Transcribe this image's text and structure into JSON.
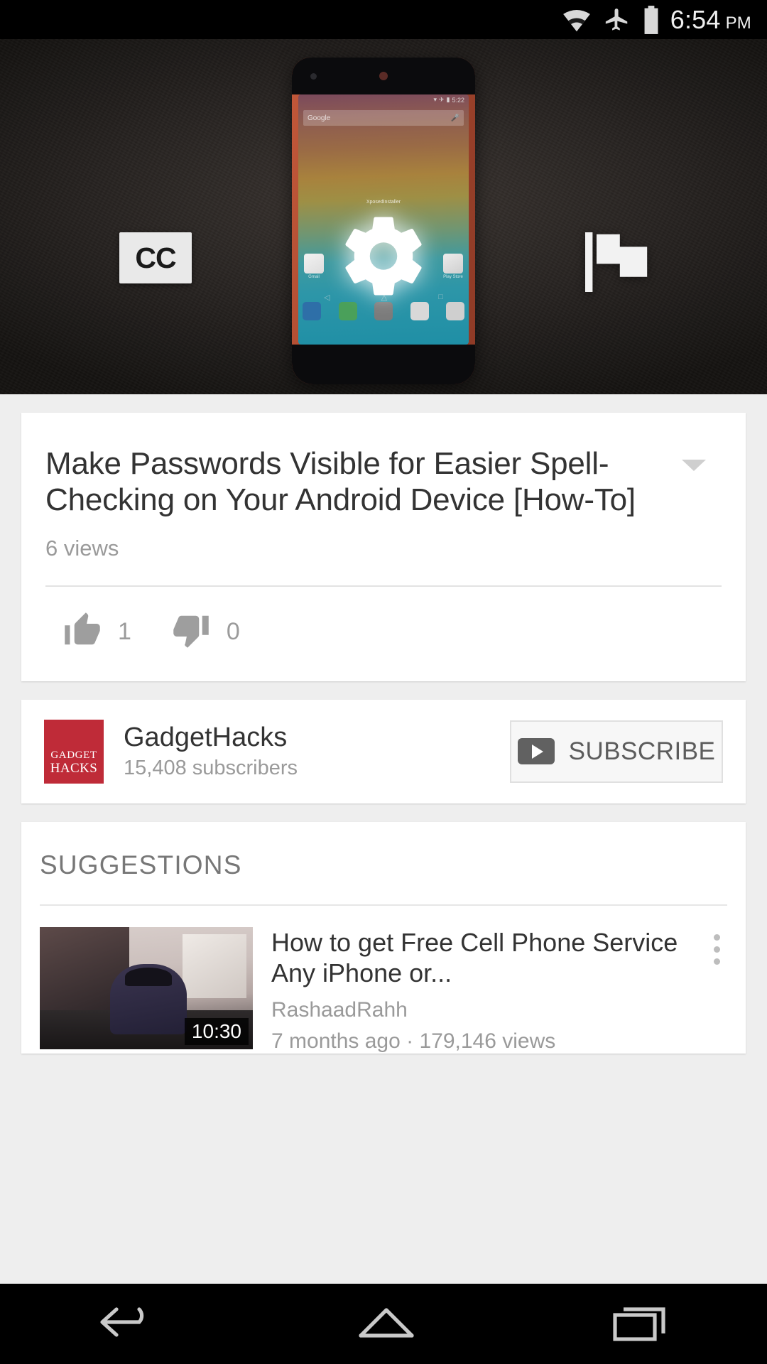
{
  "status_bar": {
    "wifi_icon": "wifi-icon",
    "airplane_icon": "airplane-mode-icon",
    "battery_icon": "battery-icon",
    "time": "6:54",
    "am_pm": "PM"
  },
  "player": {
    "cc_label": "CC",
    "settings_icon": "gear-icon",
    "flag_icon": "flag-icon",
    "thumbnail_phone": {
      "status_time": "5:22",
      "search_placeholder": "Google",
      "app_label": "XposedInstaller",
      "app_gmail": "Gmail",
      "app_playstore": "Play Store"
    }
  },
  "video": {
    "title": "Make Passwords Visible for Easier Spell-Checking on Your Android Device [How-To]",
    "views": "6 views",
    "expand_icon": "chevron-down-icon",
    "like_icon": "thumbs-up-icon",
    "like_count": "1",
    "dislike_icon": "thumbs-down-icon",
    "dislike_count": "0"
  },
  "channel": {
    "avatar_line1": "GADGET",
    "avatar_line2": "HACKS",
    "name": "GadgetHacks",
    "subscribers": "15,408 subscribers",
    "subscribe_label": "SUBSCRIBE",
    "subscribe_icon": "youtube-play-icon"
  },
  "suggestions": {
    "header": "SUGGESTIONS",
    "items": [
      {
        "title": "How to get Free Cell Phone Service Any iPhone or...",
        "channel": "RashaadRahh",
        "stats": "7 months ago · 179,146 views",
        "duration": "10:30",
        "menu_icon": "kebab-menu-icon"
      }
    ]
  },
  "navbar": {
    "back_icon": "back-icon",
    "home_icon": "home-icon",
    "recents_icon": "recent-apps-icon"
  },
  "colors": {
    "accent_red": "#bf2b38",
    "background": "#eeeeee",
    "card": "#ffffff",
    "text_primary": "#333333",
    "text_secondary": "#9a9a9a"
  }
}
